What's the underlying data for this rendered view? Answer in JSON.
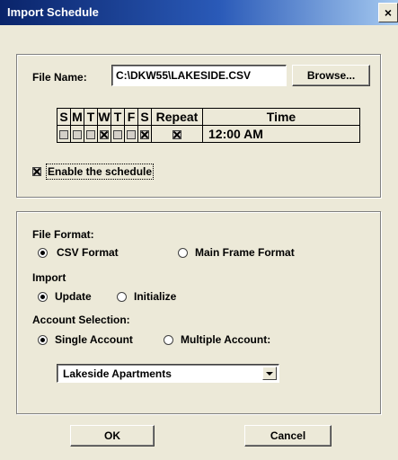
{
  "window": {
    "title": "Import Schedule",
    "close_glyph": "×"
  },
  "file": {
    "label": "File Name:",
    "value": "C:\\DKW55\\LAKESIDE.CSV",
    "browse_label": "Browse..."
  },
  "schedule": {
    "headers": [
      "S",
      "M",
      "T",
      "W",
      "T",
      "F",
      "S",
      "Repeat",
      "Time"
    ],
    "days_checked": [
      false,
      false,
      false,
      true,
      false,
      false,
      true
    ],
    "repeat_checked": true,
    "time": "12:00 AM"
  },
  "enable": {
    "label": "Enable the schedule",
    "checked": true
  },
  "file_format": {
    "label": "File Format:",
    "options": [
      "CSV Format",
      "Main Frame Format"
    ],
    "selected": 0
  },
  "import": {
    "label": "Import",
    "options": [
      "Update",
      "Initialize"
    ],
    "selected": 0
  },
  "account": {
    "label": "Account Selection:",
    "options": [
      "Single Account",
      "Multiple Account:"
    ],
    "selected": 0,
    "combo_value": "Lakeside Apartments"
  },
  "buttons": {
    "ok": "OK",
    "cancel": "Cancel"
  }
}
